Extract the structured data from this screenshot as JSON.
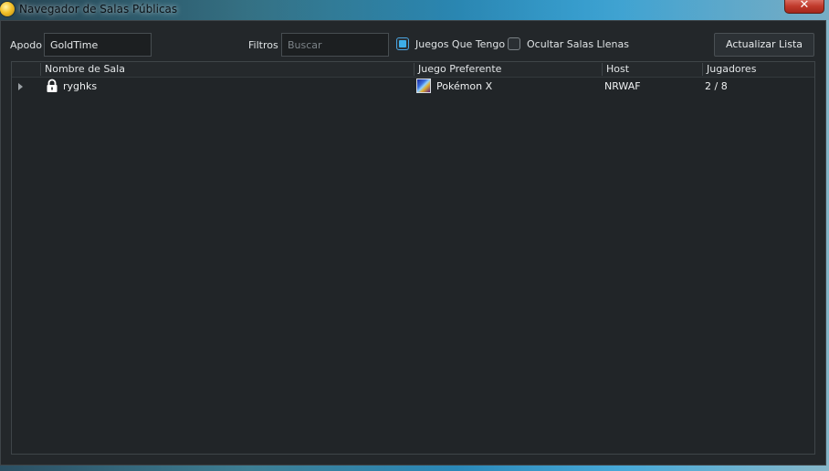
{
  "window": {
    "title": "Navegador de Salas Públicas",
    "close_glyph": "✕",
    "app_icon": "coin-icon"
  },
  "filters": {
    "nickname_label": "Apodo",
    "nickname_value": "GoldTime",
    "filters_label": "Filtros",
    "search_placeholder": "Buscar",
    "owned_games_label": "Juegos Que Tengo",
    "owned_games_checked": true,
    "hide_full_label": "Ocultar Salas Llenas",
    "hide_full_checked": false,
    "refresh_label": "Actualizar Lista"
  },
  "table": {
    "columns": [
      "Nombre de Sala",
      "Juego Preferente",
      "Host",
      "Jugadores"
    ],
    "rows": [
      {
        "locked": true,
        "room_name": "ryghks",
        "game": "Pokémon X",
        "host": "NRWAF",
        "players": "2 / 8"
      }
    ]
  },
  "colors": {
    "accent": "#3daee9",
    "window_bg": "#23272a",
    "table_bg": "#212528",
    "text": "#eef0f1"
  }
}
